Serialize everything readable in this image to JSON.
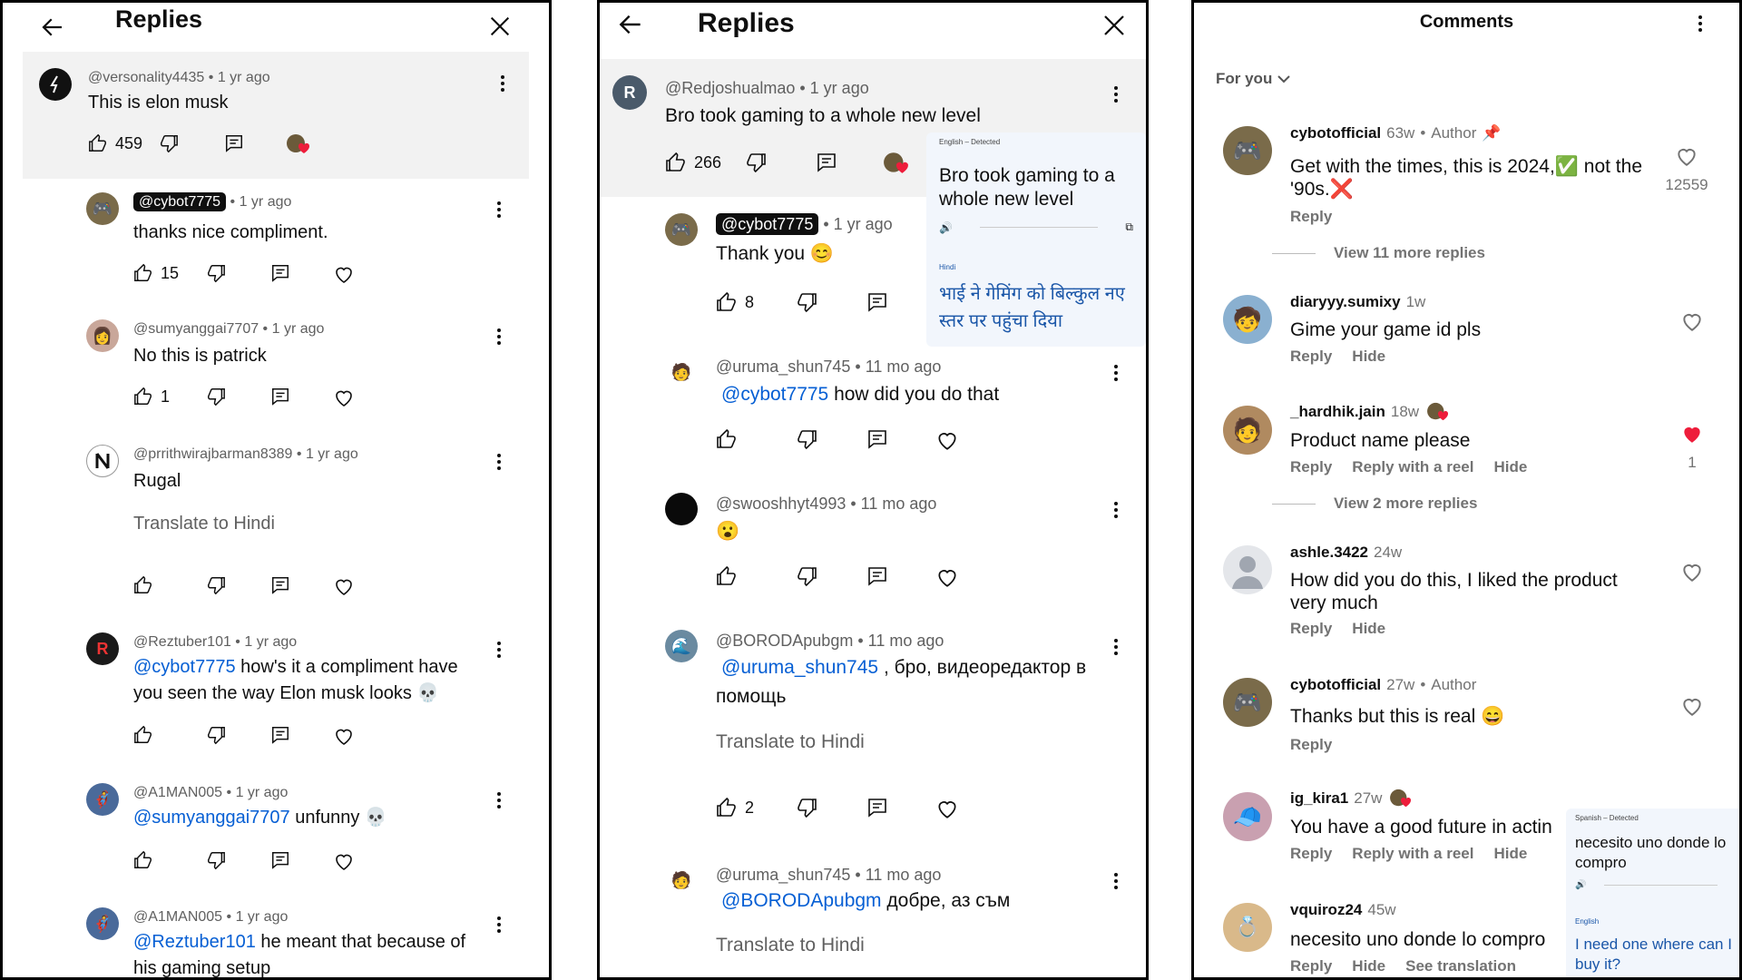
{
  "panel1": {
    "title": "Replies",
    "parent": {
      "handle": "@versonality4435",
      "time": "1 yr ago",
      "text": "This is elon musk",
      "likes": "459"
    },
    "replies": [
      {
        "handle": "@cybot7775",
        "time": "1 yr ago",
        "text": "thanks nice compliment.",
        "likes": "15",
        "creator": true
      },
      {
        "handle": "@sumyanggai7707",
        "time": "1 yr ago",
        "text": "No this is patrick",
        "likes": "1"
      },
      {
        "handle": "@prrithwirajbarman8389",
        "time": "1 yr ago",
        "text": "Rugal",
        "likes": "",
        "translate": "Translate to Hindi"
      },
      {
        "handle": "@Reztuber101",
        "time": "1 yr ago",
        "mention": "@cybot7775",
        "text": " how's it a compliment have you seen the way Elon musk looks 💀",
        "likes": ""
      },
      {
        "handle": "@A1MAN005",
        "time": "1 yr ago",
        "mention": "@sumyanggai7707",
        "text": " unfunny 💀",
        "likes": ""
      },
      {
        "handle": "@A1MAN005",
        "time": "1 yr ago",
        "mention": "@Reztuber101",
        "text": " he meant that because of his gaming setup",
        "likes": ""
      }
    ]
  },
  "panel2": {
    "title": "Replies",
    "parent": {
      "avatar_letter": "R",
      "handle": "@Redjoshualmao",
      "time": "1 yr ago",
      "text": "Bro took gaming to a whole new level",
      "likes": "266"
    },
    "translation_popup": {
      "detected": "English – Detected",
      "source": "Bro took gaming to a whole new level",
      "target_lang": "Hindi",
      "translated": "भाई ने गेमिंग को बिल्कुल नए स्तर पर पहुंचा दिया"
    },
    "replies": [
      {
        "handle": "@cybot7775",
        "time": "1 yr ago",
        "text": "Thank you 😊",
        "likes": "8",
        "creator": true
      },
      {
        "handle": "@uruma_shun745",
        "time": "11 mo ago",
        "mention": "@cybot7775",
        "text": " how did you do that",
        "likes": ""
      },
      {
        "handle": "@swooshhyt4993",
        "time": "11 mo ago",
        "text": "😮",
        "likes": ""
      },
      {
        "handle": "@BORODApubgm",
        "time": "11 mo ago",
        "mention": "@uruma_shun745",
        "text": " , бро, видеоредактор в помощь",
        "likes": "2",
        "translate": "Translate to Hindi"
      },
      {
        "handle": "@uruma_shun745",
        "time": "11 mo ago",
        "mention": "@BORODApubgm",
        "text": "  добре, аз съм",
        "likes": "",
        "translate": "Translate to Hindi"
      }
    ]
  },
  "panel3": {
    "title": "Comments",
    "filter": "For you",
    "comments": [
      {
        "user": "cybotofficial",
        "time": "63w",
        "author": "Author",
        "text": "Get with the times, this is 2024,✅ not the '90s.❌",
        "actions": [
          "Reply"
        ],
        "likes": "12559",
        "liked": false
      },
      {
        "user": "diaryyy.sumixy",
        "time": "1w",
        "text": "Gime your game id pls",
        "actions": [
          "Reply",
          "Hide"
        ],
        "likes": "",
        "liked": false
      },
      {
        "user": "_hardhik.jain",
        "time": "18w",
        "text": "Product name please",
        "actions": [
          "Reply",
          "Reply with a reel",
          "Hide"
        ],
        "likes": "1",
        "liked": true
      },
      {
        "user": "ashle.3422",
        "time": "24w",
        "text": "How did you do this, I liked the product very much",
        "actions": [
          "Reply",
          "Hide"
        ],
        "likes": "",
        "liked": false
      },
      {
        "user": "cybotofficial",
        "time": "27w",
        "author": "Author",
        "text": "Thanks but this is real 😄",
        "actions": [
          "Reply"
        ],
        "likes": "",
        "liked": false
      },
      {
        "user": "ig_kira1",
        "time": "27w",
        "text": "You have a good future in actin",
        "actions": [
          "Reply",
          "Reply with a reel",
          "Hide"
        ],
        "likes": "",
        "liked": false
      },
      {
        "user": "vquiroz24",
        "time": "45w",
        "text": "necesito uno donde lo compro",
        "actions": [
          "Reply",
          "Hide",
          "See translation"
        ],
        "likes": "",
        "liked": false
      }
    ],
    "view_more": [
      "View 11 more replies",
      "View 2 more replies"
    ],
    "translation_popup": {
      "detected": "Spanish – Detected",
      "source": "necesito uno donde lo compro",
      "target_lang": "English",
      "translated": "I need one where can I buy it?"
    }
  }
}
